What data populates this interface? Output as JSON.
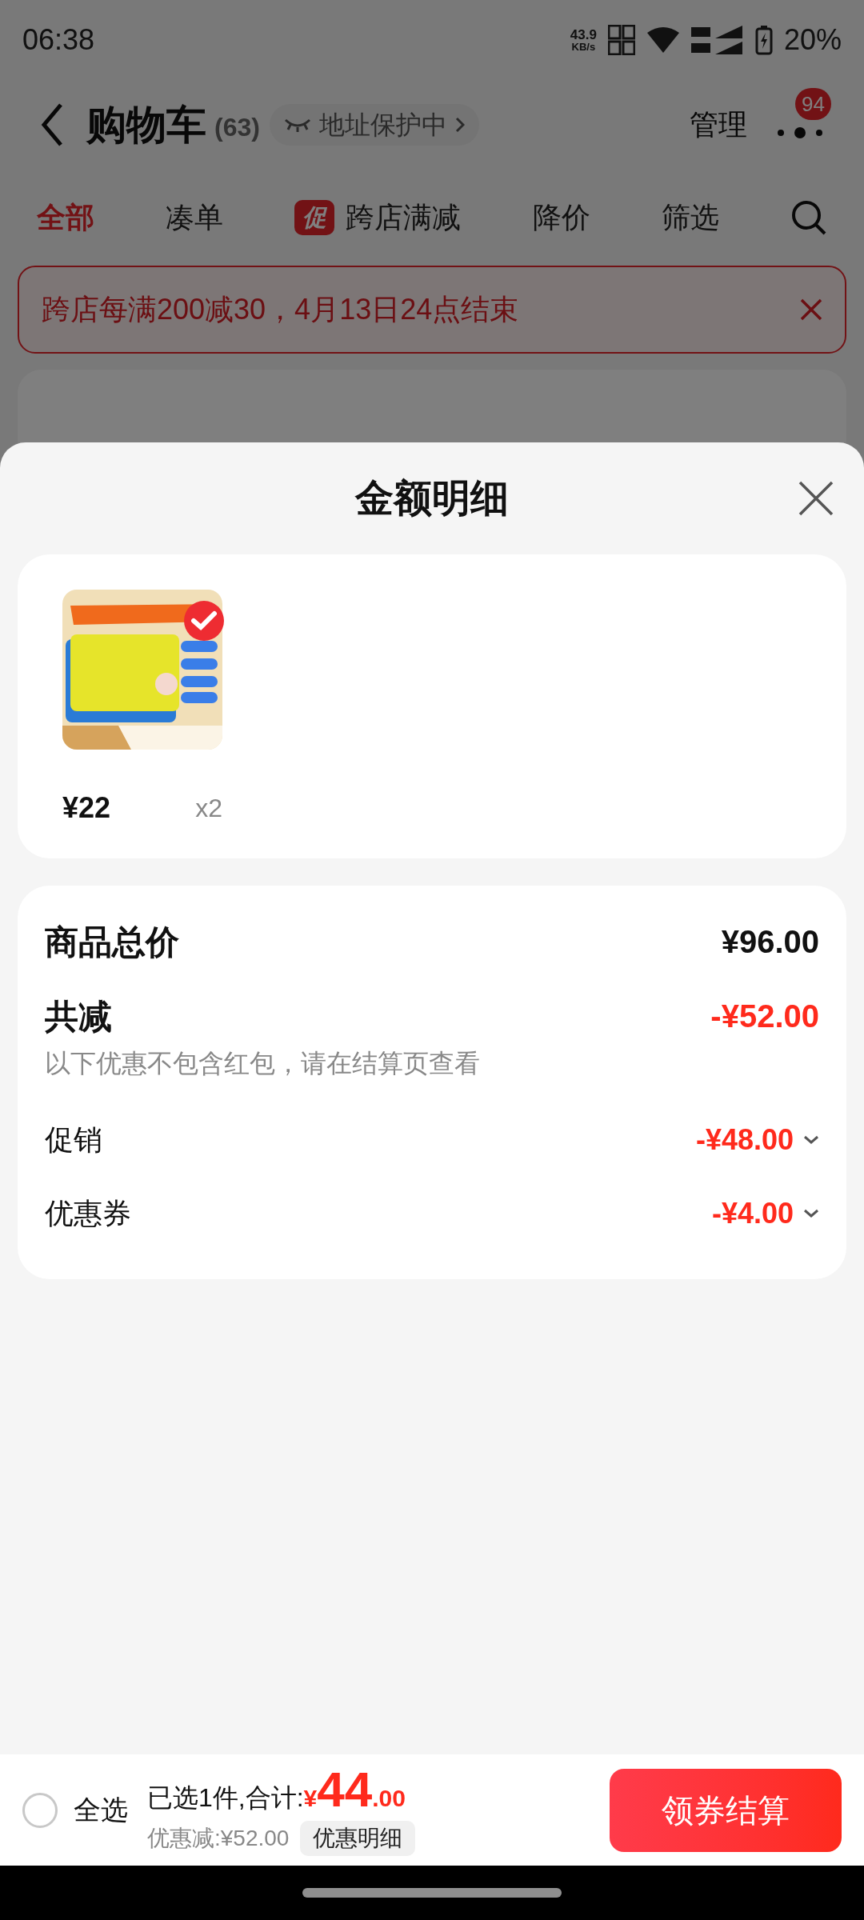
{
  "status_bar": {
    "time": "06:38",
    "net_speed": "43.9",
    "net_unit": "KB/s",
    "battery": "20%"
  },
  "header": {
    "title": "购物车",
    "count": "(63)",
    "address_badge": "地址保护中",
    "manage": "管理",
    "notification_count": "94"
  },
  "tabs": [
    {
      "label": "全部",
      "selected": true
    },
    {
      "label": "凑单",
      "selected": false
    },
    {
      "label": "跨店满减",
      "selected": false,
      "badge": "促"
    },
    {
      "label": "降价",
      "selected": false
    },
    {
      "label": "筛选",
      "selected": false
    }
  ],
  "promo_banner": {
    "text": "跨店每满200减30，4月13日24点结束"
  },
  "sheet": {
    "title": "金额明细",
    "items": [
      {
        "kind": "picture",
        "checked": true,
        "price": "¥22",
        "quantity": "x2"
      }
    ],
    "summary": [
      {
        "kind": "total",
        "label": "商品总价",
        "value": "¥96.00"
      },
      {
        "kind": "discount",
        "label": "共减",
        "value": "-¥52.00",
        "note": "以下优惠不包含红包，请在结算页查看"
      },
      {
        "kind": "detail",
        "label": "促销",
        "value": "-¥48.00"
      },
      {
        "kind": "detail",
        "label": "优惠券",
        "value": "-¥4.00"
      }
    ]
  },
  "bottom_bar": {
    "select_all": {
      "label": "全选",
      "checked": false
    },
    "selected_text": "已选1件,合计:",
    "currency": "¥",
    "total_integer": "44",
    "total_decimal": ".00",
    "savings": "优惠减:¥52.00",
    "detail_button": "优惠明细",
    "checkout_button": "领券结算"
  }
}
